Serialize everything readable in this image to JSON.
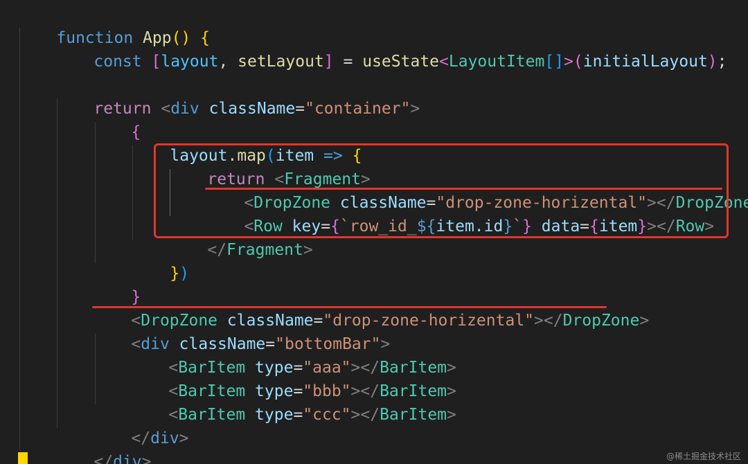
{
  "code": {
    "line1": {
      "kw": "function",
      "name": "App",
      "parens": "()",
      "brace": "{"
    },
    "line2": {
      "kw": "const",
      "open": "[",
      "var1": "layout",
      "comma": ",",
      "var2": "setLayout",
      "close": "]",
      "eq": "=",
      "hook": "useState",
      "lt": "<",
      "type": "LayoutItem",
      "arr": "[]",
      "gt": ">",
      "paren_open": "(",
      "arg": "initialLayout",
      "paren_close": ")",
      "semi": ";"
    },
    "line3": {
      "kw": "return",
      "tag_open": "<",
      "tag": "div",
      "attr": "className",
      "eq": "=",
      "value": "\"container\"",
      "tag_close": ">"
    },
    "line4": {
      "brace": "{"
    },
    "line5": {
      "obj": "layout",
      "dot": ".",
      "method": "map",
      "paren": "(",
      "param": "item",
      "arrow": "=>",
      "brace": "{"
    },
    "line6": {
      "kw": "return",
      "tag_open": "<",
      "tag": "Fragment",
      "tag_close": ">"
    },
    "line7": {
      "tag_open": "<",
      "tag": "DropZone",
      "attr": "className",
      "eq": "=",
      "value": "\"drop-zone-horizental\"",
      "mid": "></",
      "end_tag": "DropZone",
      "tag_close": ">"
    },
    "line8": {
      "tag_open": "<",
      "tag": "Row",
      "attr1": "key",
      "eq1": "=",
      "brace_open": "{",
      "tpl_start": "`row_id_",
      "interp_open": "${",
      "expr": "item.id",
      "interp_close": "}",
      "tpl_end": "`",
      "brace_close": "}",
      "attr2": "data",
      "eq2": "=",
      "brace_open2": "{",
      "expr2": "item",
      "brace_close2": "}",
      "mid": "></",
      "end_tag": "Row",
      "tag_close": ">"
    },
    "line9": {
      "tag_open": "</",
      "tag": "Fragment",
      "tag_close": ">"
    },
    "line10": {
      "brace": "}",
      "paren": ")"
    },
    "line11": {
      "brace": "}"
    },
    "line12": {
      "tag_open": "<",
      "tag": "DropZone",
      "attr": "className",
      "eq": "=",
      "value": "\"drop-zone-horizental\"",
      "mid": "></",
      "end_tag": "DropZone",
      "tag_close": ">"
    },
    "line13": {
      "tag_open": "<",
      "tag": "div",
      "attr": "className",
      "eq": "=",
      "value": "\"bottomBar\"",
      "tag_close": ">"
    },
    "line14": {
      "tag_open": "<",
      "tag": "BarItem",
      "attr": "type",
      "eq": "=",
      "value": "\"aaa\"",
      "mid": "></",
      "end_tag": "BarItem",
      "tag_close": ">"
    },
    "line15": {
      "tag_open": "<",
      "tag": "BarItem",
      "attr": "type",
      "eq": "=",
      "value": "\"bbb\"",
      "mid": "></",
      "end_tag": "BarItem",
      "tag_close": ">"
    },
    "line16": {
      "tag_open": "<",
      "tag": "BarItem",
      "attr": "type",
      "eq": "=",
      "value": "\"ccc\"",
      "mid": "></",
      "end_tag": "BarItem",
      "tag_close": ">"
    },
    "line17": {
      "tag_open": "</",
      "tag": "div",
      "tag_close": ">"
    },
    "line18": {
      "tag_open": "</",
      "tag": "div",
      "tag_close": ">"
    }
  },
  "watermark": "@稀土掘金技术社区",
  "colors": {
    "background": "#1f1f1f",
    "highlight": "#e0372b",
    "keyword": "#569cd6",
    "control_keyword": "#c586c0",
    "function": "#dcdcaa",
    "type": "#4ec9b0",
    "variable": "#9cdcfe",
    "string": "#ce9178",
    "tag_bracket": "#808080",
    "bracket_1": "#ffd700",
    "bracket_2": "#da70d6",
    "bracket_3": "#179fff"
  }
}
